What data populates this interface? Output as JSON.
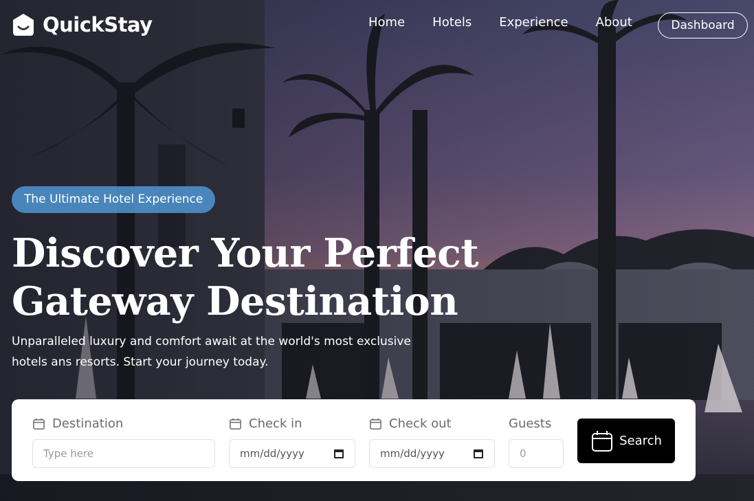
{
  "brand": {
    "name": "QuickStay"
  },
  "nav": {
    "links": [
      "Home",
      "Hotels",
      "Experience",
      "About"
    ],
    "dashboard_label": "Dashboard"
  },
  "hero": {
    "badge": "The Ultimate Hotel Experience",
    "headline_line1": "Discover Your Perfect",
    "headline_line2": "Gateway Destination",
    "subtext_line1": "Unparalleled luxury and comfort await at the world's most exclusive",
    "subtext_line2": "hotels ans resorts. Start your journey today."
  },
  "search": {
    "destination_label": "Destination",
    "destination_placeholder": "Type here",
    "checkin_label": "Check in",
    "checkin_value": "mm/dd/yyyy",
    "checkout_label": "Check out",
    "checkout_value": "mm/dd/yyyy",
    "guests_label": "Guests",
    "guests_value": "0",
    "button_label": "Search"
  },
  "icons": {
    "logo": "quickstay-logo-icon",
    "calendar": "calendar-icon",
    "date_picker": "calendar-picker-icon"
  },
  "colors": {
    "badge_bg": "#5096d2",
    "search_button_bg": "#000000",
    "card_bg": "#ffffff"
  }
}
